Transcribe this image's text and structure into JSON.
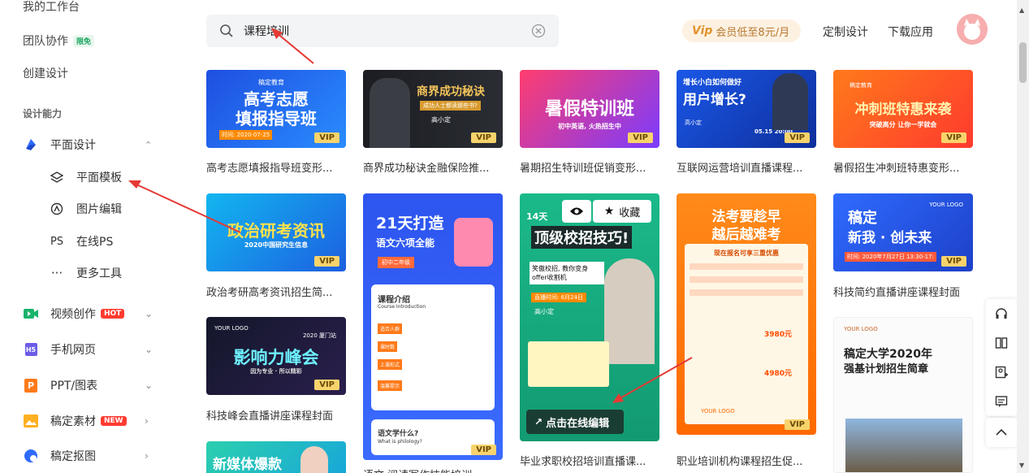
{
  "sidebar": {
    "top_item": "我的工作台",
    "team": {
      "label": "团队协作",
      "badge": "限免"
    },
    "create": "创建设计",
    "section": "设计能力",
    "graphic": {
      "label": "平面设计",
      "chev": "⌃"
    },
    "sub_items": [
      {
        "label": "平面模板",
        "icon": "layers-icon"
      },
      {
        "label": "图片编辑",
        "icon": "image-edit-icon"
      },
      {
        "label": "在线PS",
        "icon": "ps-icon",
        "glyph": "PS"
      },
      {
        "label": "更多工具",
        "icon": "more-icon",
        "glyph": "···"
      }
    ],
    "nav_items": [
      {
        "label": "视频创作",
        "badge": "HOT",
        "icon": "video-icon",
        "color": "#19b36b"
      },
      {
        "label": "手机网页",
        "icon": "h5-icon",
        "color": "#6c5ce7",
        "glyph": "H5"
      },
      {
        "label": "PPT/图表",
        "icon": "ppt-icon",
        "color": "#ff7a1a",
        "glyph": "P"
      },
      {
        "label": "稿定素材",
        "badge": "NEW",
        "icon": "material-icon",
        "color": "#ffb020"
      },
      {
        "label": "稿定抠图",
        "icon": "cutout-icon",
        "color": "#2f6bff"
      }
    ]
  },
  "search": {
    "value": "课程培训"
  },
  "header": {
    "vip_icon": "Vip",
    "vip_label": "会员低至8元/月",
    "custom": "定制设计",
    "download": "下载应用"
  },
  "cards": {
    "vip": "VIP",
    "c1": {
      "title1": "高考志愿",
      "title2": "填报指导班",
      "tag": "稿定教育",
      "date": "时间: 2020-07-25",
      "caption": "高考志愿填报指导班变形..."
    },
    "c2": {
      "title": "商界成功秘诀",
      "sub": "成功人士都读那些书?",
      "name": "高小定",
      "caption": "商界成功秘诀金融保险推..."
    },
    "c3": {
      "title": "暑假特训班",
      "sub": "初中英语, 火热招生中",
      "caption": "暑期招生特训班促销变形..."
    },
    "c4": {
      "title1": "增长小白如何做好",
      "title2": "用户增长?",
      "name": "高小定",
      "date": "05.15  20:00",
      "caption": "互联网运营培训直播课程..."
    },
    "c5": {
      "title": "冲刺班特惠来袭",
      "sub": "突破高分 让你一学就会",
      "tag": "稿定教育",
      "caption": "暑假招生冲刺班特惠变形..."
    },
    "c6": {
      "title": "政治研考资讯",
      "sub": "2020中国研究生信息",
      "caption": "政治考研高考资讯招生简..."
    },
    "c7": {
      "title1": "21天打造",
      "title2": "语文六项全能",
      "tag": "初中二年级",
      "s1": "课程介绍",
      "s1en": "Course Introduction",
      "s2": "语文学什么?",
      "s2en": "What is philology?",
      "rows": [
        "适合人群",
        "课时数",
        "上课形式",
        "温馨提示"
      ]
    },
    "c8": {
      "title1": "14天",
      "title2": "顶级校招技巧!",
      "sub": "笑傲校招, 教你变身offer收割机",
      "time": "直播时间: 6月24日",
      "name": "高小定",
      "eye": "view-icon",
      "fav": "收藏",
      "edit": "点击在线编辑",
      "caption": "毕业求职校招培训直播课..."
    },
    "c9": {
      "title1": "法考要趁早",
      "title2": "越后越难考",
      "sub": "现在报名可享三重优惠",
      "price1": "3980元",
      "price2": "4980元",
      "logo": "YOUR LOGO",
      "caption": "职业培训机构课程招生促..."
    },
    "c10": {
      "title1": "稿定",
      "title2": "新我 · 创未来",
      "logo": "YOUR LOGO",
      "date": "时间: 2020年7月27日 13:30-17:",
      "caption": "科技简约直播讲座课程封面"
    },
    "c11": {
      "title": "影响力峰会",
      "sub": "因为专业 · 所以精彩",
      "logo": "YOUR LOGO",
      "tag": "2020 厦门站",
      "caption": "科技峰会直播讲座课程封面"
    },
    "c12": {
      "title1": "稿定大学2020年",
      "title2": "强基计划招生简章",
      "logo": "YOUR LOGO"
    },
    "c13": {
      "title": "新媒体爆款"
    },
    "c14": {
      "caption": "语文·阅读写作技能培训..."
    }
  },
  "right_tools": [
    "headset-icon",
    "compare-icon",
    "profile-add-icon",
    "feedback-icon",
    "back-top-icon"
  ],
  "colors": {
    "accent": "#ff5a3c",
    "vip_gold": "#f8d36c"
  }
}
